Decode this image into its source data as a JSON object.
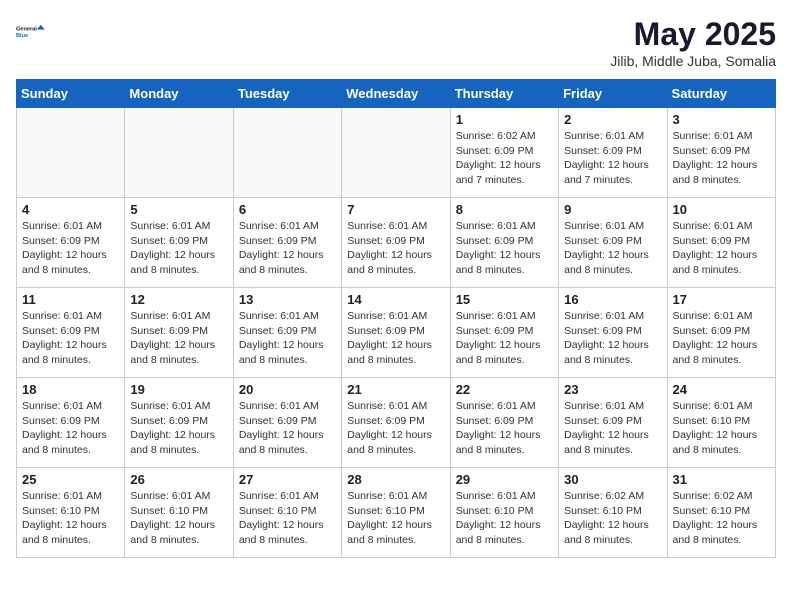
{
  "header": {
    "logo_line1": "General",
    "logo_line2": "Blue",
    "month_title": "May 2025",
    "location": "Jilib, Middle Juba, Somalia"
  },
  "days_of_week": [
    "Sunday",
    "Monday",
    "Tuesday",
    "Wednesday",
    "Thursday",
    "Friday",
    "Saturday"
  ],
  "weeks": [
    [
      {
        "day": "",
        "info": ""
      },
      {
        "day": "",
        "info": ""
      },
      {
        "day": "",
        "info": ""
      },
      {
        "day": "",
        "info": ""
      },
      {
        "day": "1",
        "info": "Sunrise: 6:02 AM\nSunset: 6:09 PM\nDaylight: 12 hours and 7 minutes."
      },
      {
        "day": "2",
        "info": "Sunrise: 6:01 AM\nSunset: 6:09 PM\nDaylight: 12 hours and 7 minutes."
      },
      {
        "day": "3",
        "info": "Sunrise: 6:01 AM\nSunset: 6:09 PM\nDaylight: 12 hours and 8 minutes."
      }
    ],
    [
      {
        "day": "4",
        "info": "Sunrise: 6:01 AM\nSunset: 6:09 PM\nDaylight: 12 hours and 8 minutes."
      },
      {
        "day": "5",
        "info": "Sunrise: 6:01 AM\nSunset: 6:09 PM\nDaylight: 12 hours and 8 minutes."
      },
      {
        "day": "6",
        "info": "Sunrise: 6:01 AM\nSunset: 6:09 PM\nDaylight: 12 hours and 8 minutes."
      },
      {
        "day": "7",
        "info": "Sunrise: 6:01 AM\nSunset: 6:09 PM\nDaylight: 12 hours and 8 minutes."
      },
      {
        "day": "8",
        "info": "Sunrise: 6:01 AM\nSunset: 6:09 PM\nDaylight: 12 hours and 8 minutes."
      },
      {
        "day": "9",
        "info": "Sunrise: 6:01 AM\nSunset: 6:09 PM\nDaylight: 12 hours and 8 minutes."
      },
      {
        "day": "10",
        "info": "Sunrise: 6:01 AM\nSunset: 6:09 PM\nDaylight: 12 hours and 8 minutes."
      }
    ],
    [
      {
        "day": "11",
        "info": "Sunrise: 6:01 AM\nSunset: 6:09 PM\nDaylight: 12 hours and 8 minutes."
      },
      {
        "day": "12",
        "info": "Sunrise: 6:01 AM\nSunset: 6:09 PM\nDaylight: 12 hours and 8 minutes."
      },
      {
        "day": "13",
        "info": "Sunrise: 6:01 AM\nSunset: 6:09 PM\nDaylight: 12 hours and 8 minutes."
      },
      {
        "day": "14",
        "info": "Sunrise: 6:01 AM\nSunset: 6:09 PM\nDaylight: 12 hours and 8 minutes."
      },
      {
        "day": "15",
        "info": "Sunrise: 6:01 AM\nSunset: 6:09 PM\nDaylight: 12 hours and 8 minutes."
      },
      {
        "day": "16",
        "info": "Sunrise: 6:01 AM\nSunset: 6:09 PM\nDaylight: 12 hours and 8 minutes."
      },
      {
        "day": "17",
        "info": "Sunrise: 6:01 AM\nSunset: 6:09 PM\nDaylight: 12 hours and 8 minutes."
      }
    ],
    [
      {
        "day": "18",
        "info": "Sunrise: 6:01 AM\nSunset: 6:09 PM\nDaylight: 12 hours and 8 minutes."
      },
      {
        "day": "19",
        "info": "Sunrise: 6:01 AM\nSunset: 6:09 PM\nDaylight: 12 hours and 8 minutes."
      },
      {
        "day": "20",
        "info": "Sunrise: 6:01 AM\nSunset: 6:09 PM\nDaylight: 12 hours and 8 minutes."
      },
      {
        "day": "21",
        "info": "Sunrise: 6:01 AM\nSunset: 6:09 PM\nDaylight: 12 hours and 8 minutes."
      },
      {
        "day": "22",
        "info": "Sunrise: 6:01 AM\nSunset: 6:09 PM\nDaylight: 12 hours and 8 minutes."
      },
      {
        "day": "23",
        "info": "Sunrise: 6:01 AM\nSunset: 6:09 PM\nDaylight: 12 hours and 8 minutes."
      },
      {
        "day": "24",
        "info": "Sunrise: 6:01 AM\nSunset: 6:10 PM\nDaylight: 12 hours and 8 minutes."
      }
    ],
    [
      {
        "day": "25",
        "info": "Sunrise: 6:01 AM\nSunset: 6:10 PM\nDaylight: 12 hours and 8 minutes."
      },
      {
        "day": "26",
        "info": "Sunrise: 6:01 AM\nSunset: 6:10 PM\nDaylight: 12 hours and 8 minutes."
      },
      {
        "day": "27",
        "info": "Sunrise: 6:01 AM\nSunset: 6:10 PM\nDaylight: 12 hours and 8 minutes."
      },
      {
        "day": "28",
        "info": "Sunrise: 6:01 AM\nSunset: 6:10 PM\nDaylight: 12 hours and 8 minutes."
      },
      {
        "day": "29",
        "info": "Sunrise: 6:01 AM\nSunset: 6:10 PM\nDaylight: 12 hours and 8 minutes."
      },
      {
        "day": "30",
        "info": "Sunrise: 6:02 AM\nSunset: 6:10 PM\nDaylight: 12 hours and 8 minutes."
      },
      {
        "day": "31",
        "info": "Sunrise: 6:02 AM\nSunset: 6:10 PM\nDaylight: 12 hours and 8 minutes."
      }
    ]
  ]
}
